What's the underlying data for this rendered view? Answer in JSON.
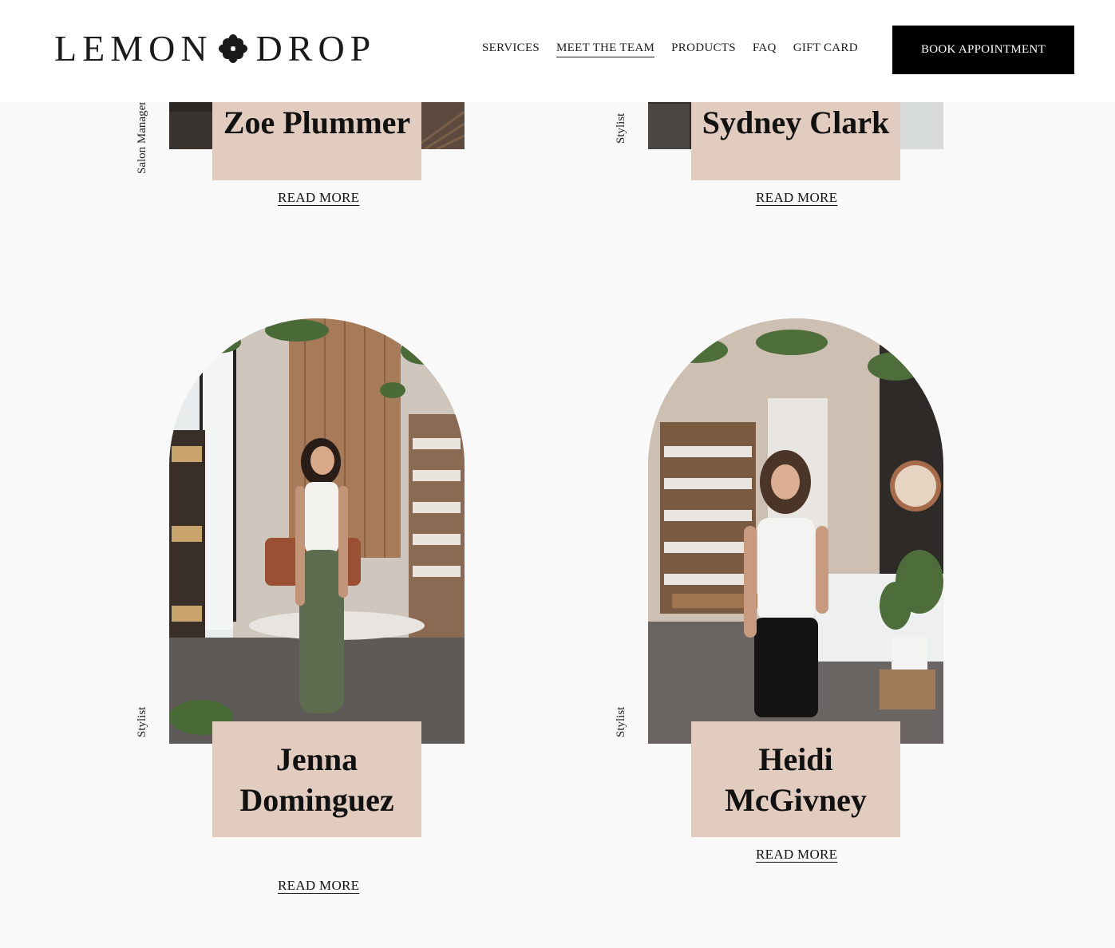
{
  "header": {
    "logo_left": "LEMON",
    "logo_right": "DROP",
    "nav": [
      {
        "label": "SERVICES",
        "active": false
      },
      {
        "label": "MEET THE TEAM",
        "active": true
      },
      {
        "label": "PRODUCTS",
        "active": false
      },
      {
        "label": "FAQ",
        "active": false
      },
      {
        "label": "GIFT CARD",
        "active": false
      }
    ],
    "book_label": "BOOK APPOINTMENT"
  },
  "team": [
    {
      "name": "Zoe Plummer",
      "role": "Salon Manager",
      "read_more": "READ MORE"
    },
    {
      "name": "Sydney Clark",
      "role": "Stylist",
      "read_more": "READ MORE"
    },
    {
      "name": "Jenna Dominguez",
      "role": "Stylist",
      "read_more": "READ MORE"
    },
    {
      "name": "Heidi McGivney",
      "role": "Stylist",
      "read_more": "READ MORE"
    }
  ],
  "colors": {
    "name_box": "#e2cbbf",
    "page_bg": "#f9f9f9",
    "button_bg": "#000000"
  }
}
